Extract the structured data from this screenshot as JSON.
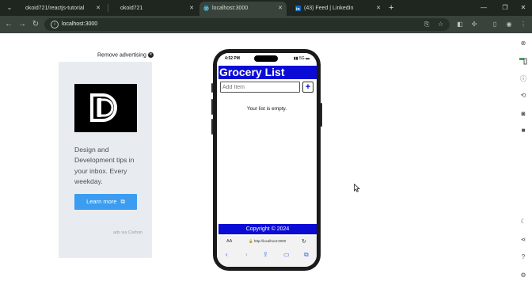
{
  "browser": {
    "tabs": [
      {
        "title": "okoid721/reactjs-tutorial",
        "active": false
      },
      {
        "title": "okoid721",
        "active": false
      },
      {
        "title": "localhost:3000",
        "active": true
      },
      {
        "title": "(43) Feed | LinkedIn",
        "active": false
      }
    ],
    "url": "localhost:3000",
    "colors": {
      "chrome_dark": "#1f2620",
      "chrome_toolbar": "#39433b"
    }
  },
  "ad": {
    "remove_label": "Remove advertising",
    "text": "Design and Development tips in your inbox. Every weekday.",
    "button_label": "Learn more",
    "via": "ads via Carbon"
  },
  "phone": {
    "status_time": "4:52 PM",
    "status_right": "▮▮ 5G ▬",
    "safari_aa": "AA",
    "safari_url": "http://localhost:3000",
    "app": {
      "title": "Grocery List",
      "input_placeholder": "Add Item",
      "add_button": "+",
      "empty_message": "Your list is empty.",
      "footer": "Copyright © 2024",
      "colors": {
        "header": "#0b0bd6",
        "footer": "#0b0bd6"
      }
    }
  },
  "icons": {
    "tab_menu": "chevron-down-icon",
    "back": "back-arrow-icon",
    "forward": "forward-arrow-icon",
    "reload": "reload-icon",
    "site_info": "info-icon",
    "install": "install-app-icon",
    "bookmark": "star-icon",
    "extensions": "puzzle-icon",
    "sidebar": "sidebar-icon",
    "profile": "profile-icon",
    "menu": "kebab-menu-icon"
  }
}
